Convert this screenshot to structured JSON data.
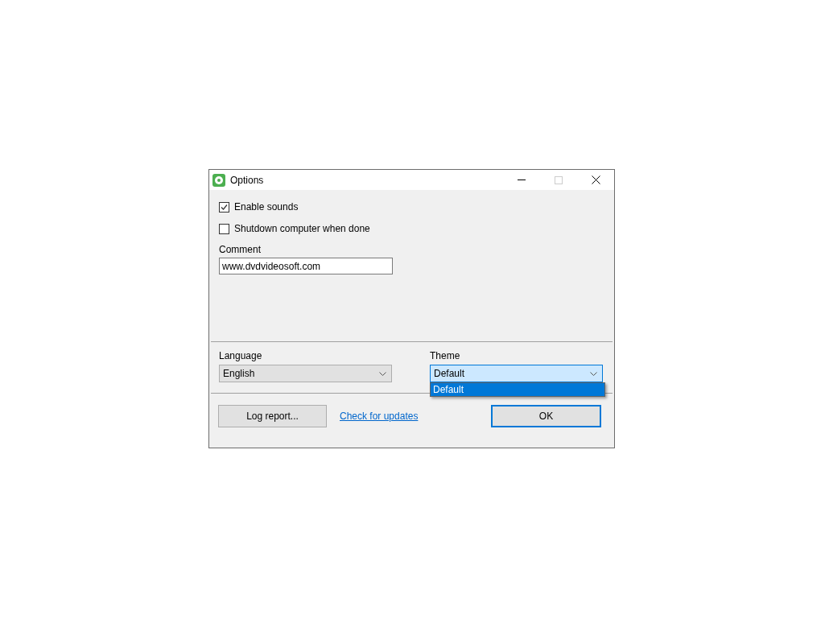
{
  "window": {
    "title": "Options"
  },
  "options": [
    {
      "label": "Enable sounds",
      "checked": true
    },
    {
      "label": "Shutdown computer when done",
      "checked": false
    }
  ],
  "comment": {
    "label": "Comment",
    "value": "www.dvdvideosoft.com"
  },
  "language": {
    "label": "Language",
    "value": "English",
    "focused": false
  },
  "theme": {
    "label": "Theme",
    "value": "Default",
    "focused": true,
    "expanded": true,
    "options": [
      {
        "label": "Default",
        "selected": true
      }
    ]
  },
  "footer": {
    "log_button": "Log report...",
    "update_link": "Check for updates",
    "ok_button": "OK",
    "ok_default": true
  }
}
